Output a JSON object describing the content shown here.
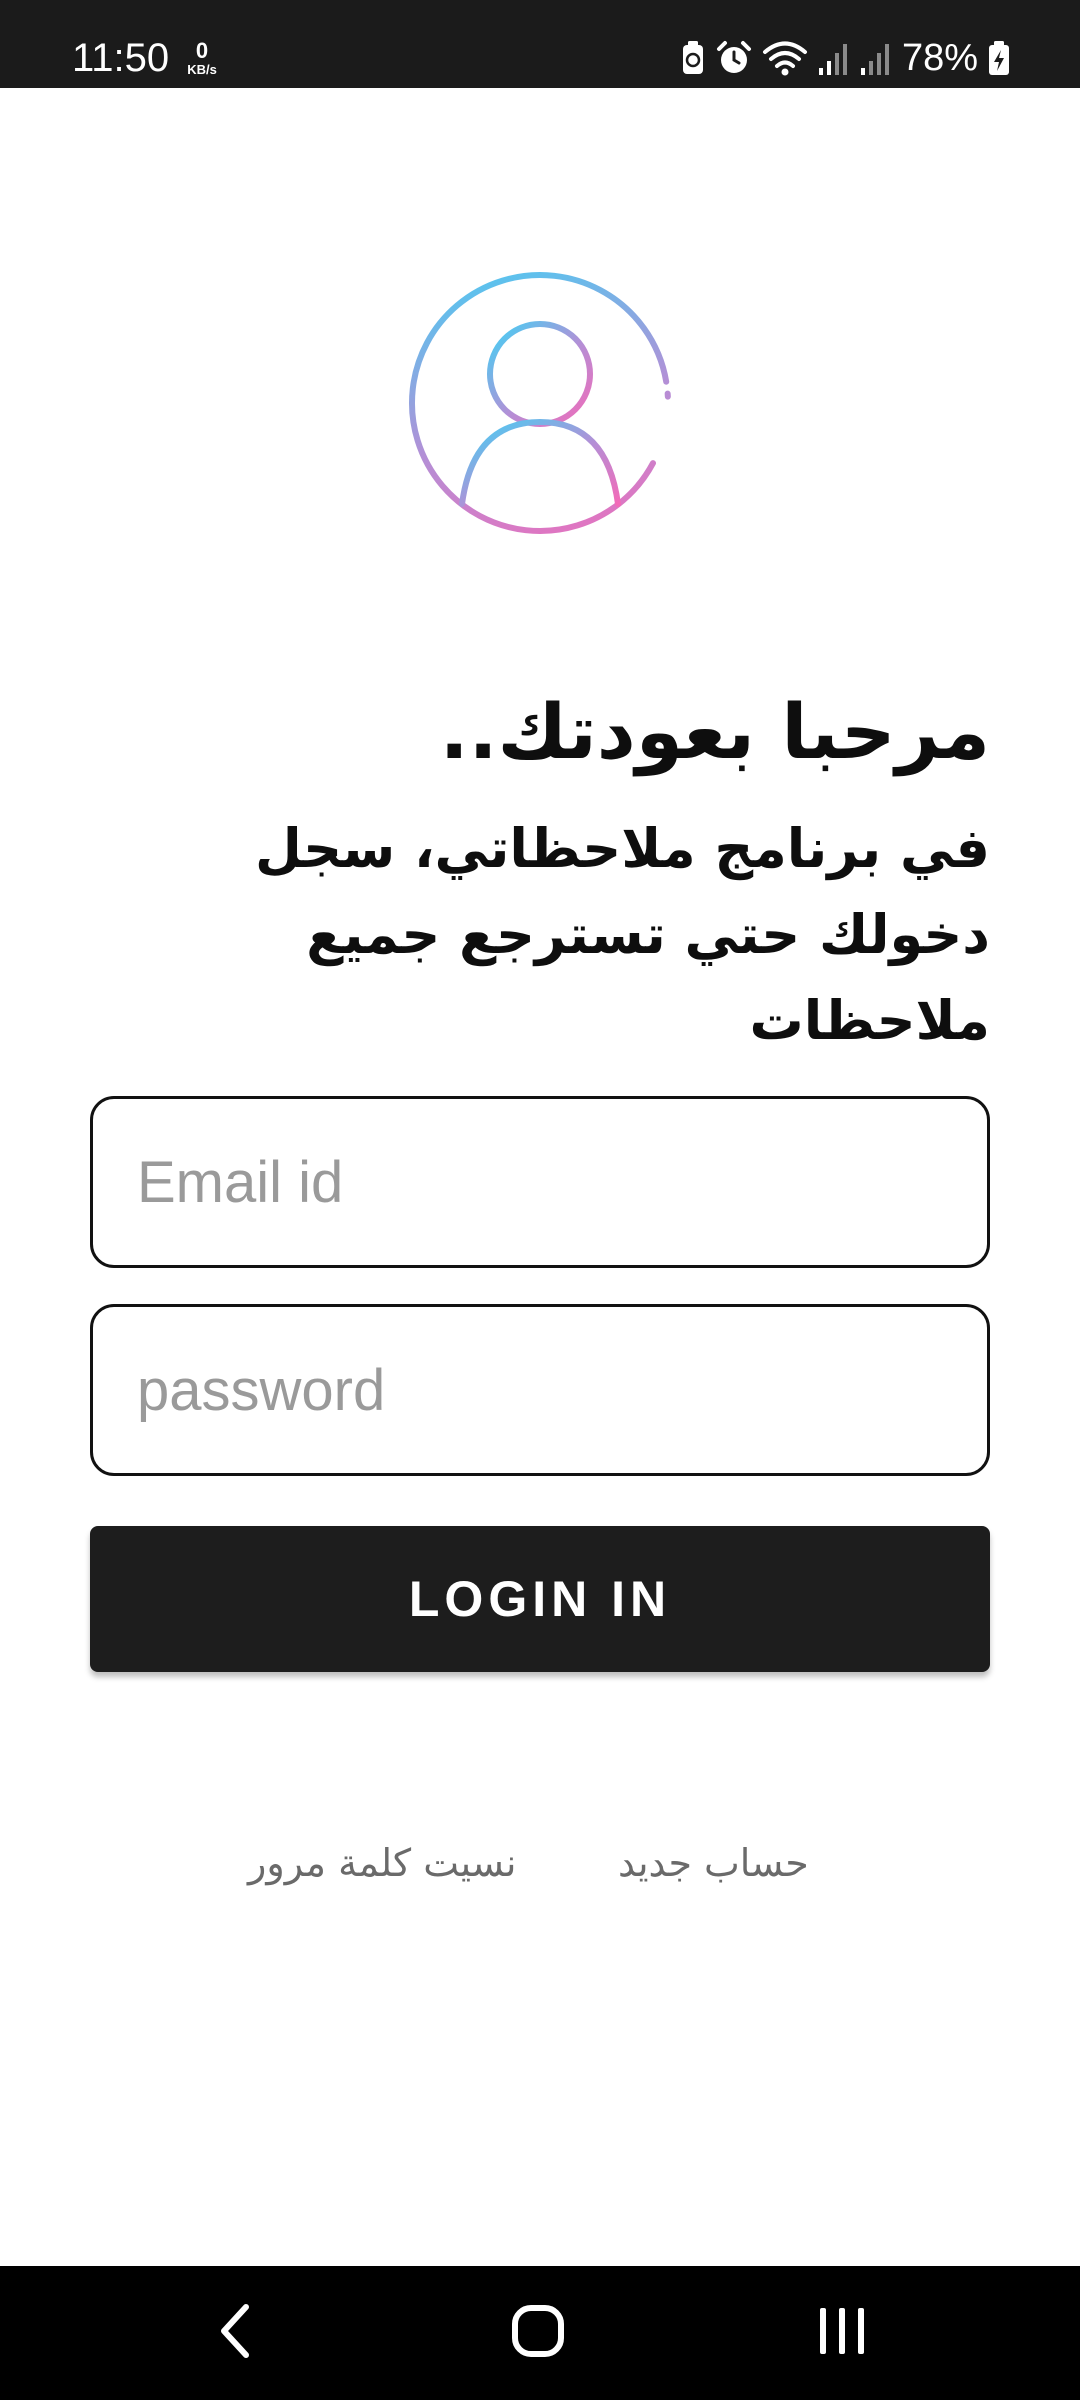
{
  "status_bar": {
    "time": "11:50",
    "net_speed_value": "0",
    "net_speed_unit": "KB/s",
    "battery_percent": "78%",
    "icons": [
      "battery-saver-icon",
      "alarm-icon",
      "wifi-icon",
      "signal-icon",
      "signal-icon",
      "battery-charging-icon"
    ]
  },
  "login": {
    "welcome_title": "مرحبا بعودتك..",
    "welcome_subtitle": "في برنامج ملاحظاتي، سجل دخولك حتي تسترجع جميع ملاحظات",
    "email_placeholder": "Email id",
    "password_placeholder": "password",
    "login_button": "LOGIN IN",
    "forgot_password": "نسيت كلمة مرور",
    "new_account": "حساب جديد"
  },
  "nav_bar": {
    "icons": [
      "back-icon",
      "home-icon",
      "recents-icon"
    ]
  },
  "colors": {
    "status_bar_bg": "#1b1b1b",
    "button_bg": "#1d1d1d",
    "avatar_gradient_start": "#3fd3f5",
    "avatar_gradient_end": "#f36ab8",
    "link_text": "#6a6a6a",
    "placeholder_text": "#9a9a9a"
  }
}
